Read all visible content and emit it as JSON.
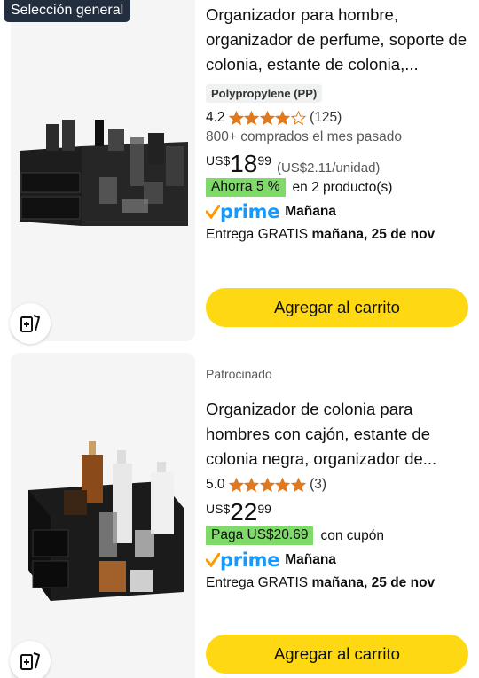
{
  "products": [
    {
      "badge": "Selección general",
      "title": "Organizador para hombre, organizador de perfume, soporte de colonia, estante de colonia,...",
      "material": "Polypropylene (PP)",
      "rating": "4.2",
      "rating_stars": 4.2,
      "rating_count": "(125)",
      "bought": "800+ comprados el mes pasado",
      "price_currency": "US$",
      "price_whole": "18",
      "price_fraction": "99",
      "unit_price": "(US$2.11/unidad)",
      "deal_label": "Ahorra 5 %",
      "deal_suffix": "en 2 producto(s)",
      "prime_label": "prime",
      "prime_day": "Mañana",
      "delivery_prefix": "Entrega GRATIS",
      "delivery_date": "mañana, 25 de nov",
      "cart_label": "Agregar al carrito"
    },
    {
      "sponsored": "Patrocinado",
      "title": "Organizador de colonia para hombres con cajón, estante de colonia negra, organizador de...",
      "rating": "5.0",
      "rating_stars": 5.0,
      "rating_count": "(3)",
      "price_currency": "US$",
      "price_whole": "22",
      "price_fraction": "99",
      "deal_label": "Paga US$20.69",
      "deal_suffix": "con cupón",
      "prime_label": "prime",
      "prime_day": "Mañana",
      "delivery_prefix": "Entrega GRATIS",
      "delivery_date": "mañana, 25 de nov",
      "cart_label": "Agregar al carrito"
    }
  ],
  "colors": {
    "cart_button": "#ffd814",
    "deal_badge": "#7fda69",
    "star": "#de7921",
    "prime_blue": "#1399ff",
    "prime_check": "#f90",
    "badge_bg": "#232f3e"
  },
  "icons": {
    "compare": "compare-cards-icon",
    "star": "star-icon",
    "prime_check": "prime-check-icon"
  }
}
